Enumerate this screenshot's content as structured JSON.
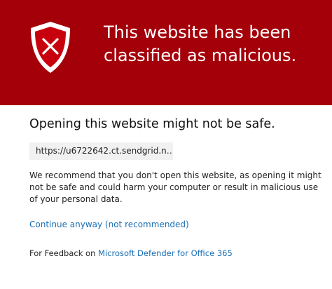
{
  "banner": {
    "title_line1": "This website has been",
    "title_line2": "classified as malicious.",
    "icon": "shield-x-icon",
    "background_color": "#a4000a"
  },
  "main": {
    "heading": "Opening this website might not be safe.",
    "url": "https://u6722642.ct.sendgrid.n…",
    "body_text": "We recommend that you don't open this website, as opening it might not be safe and could harm your computer or result in malicious use of your personal data.",
    "continue_link": "Continue anyway (not recommended)",
    "feedback_prefix": "For Feedback on ",
    "feedback_link": "Microsoft Defender for Office 365"
  },
  "colors": {
    "link": "#1a6fb5",
    "url_box_bg": "#f1f1f1"
  }
}
